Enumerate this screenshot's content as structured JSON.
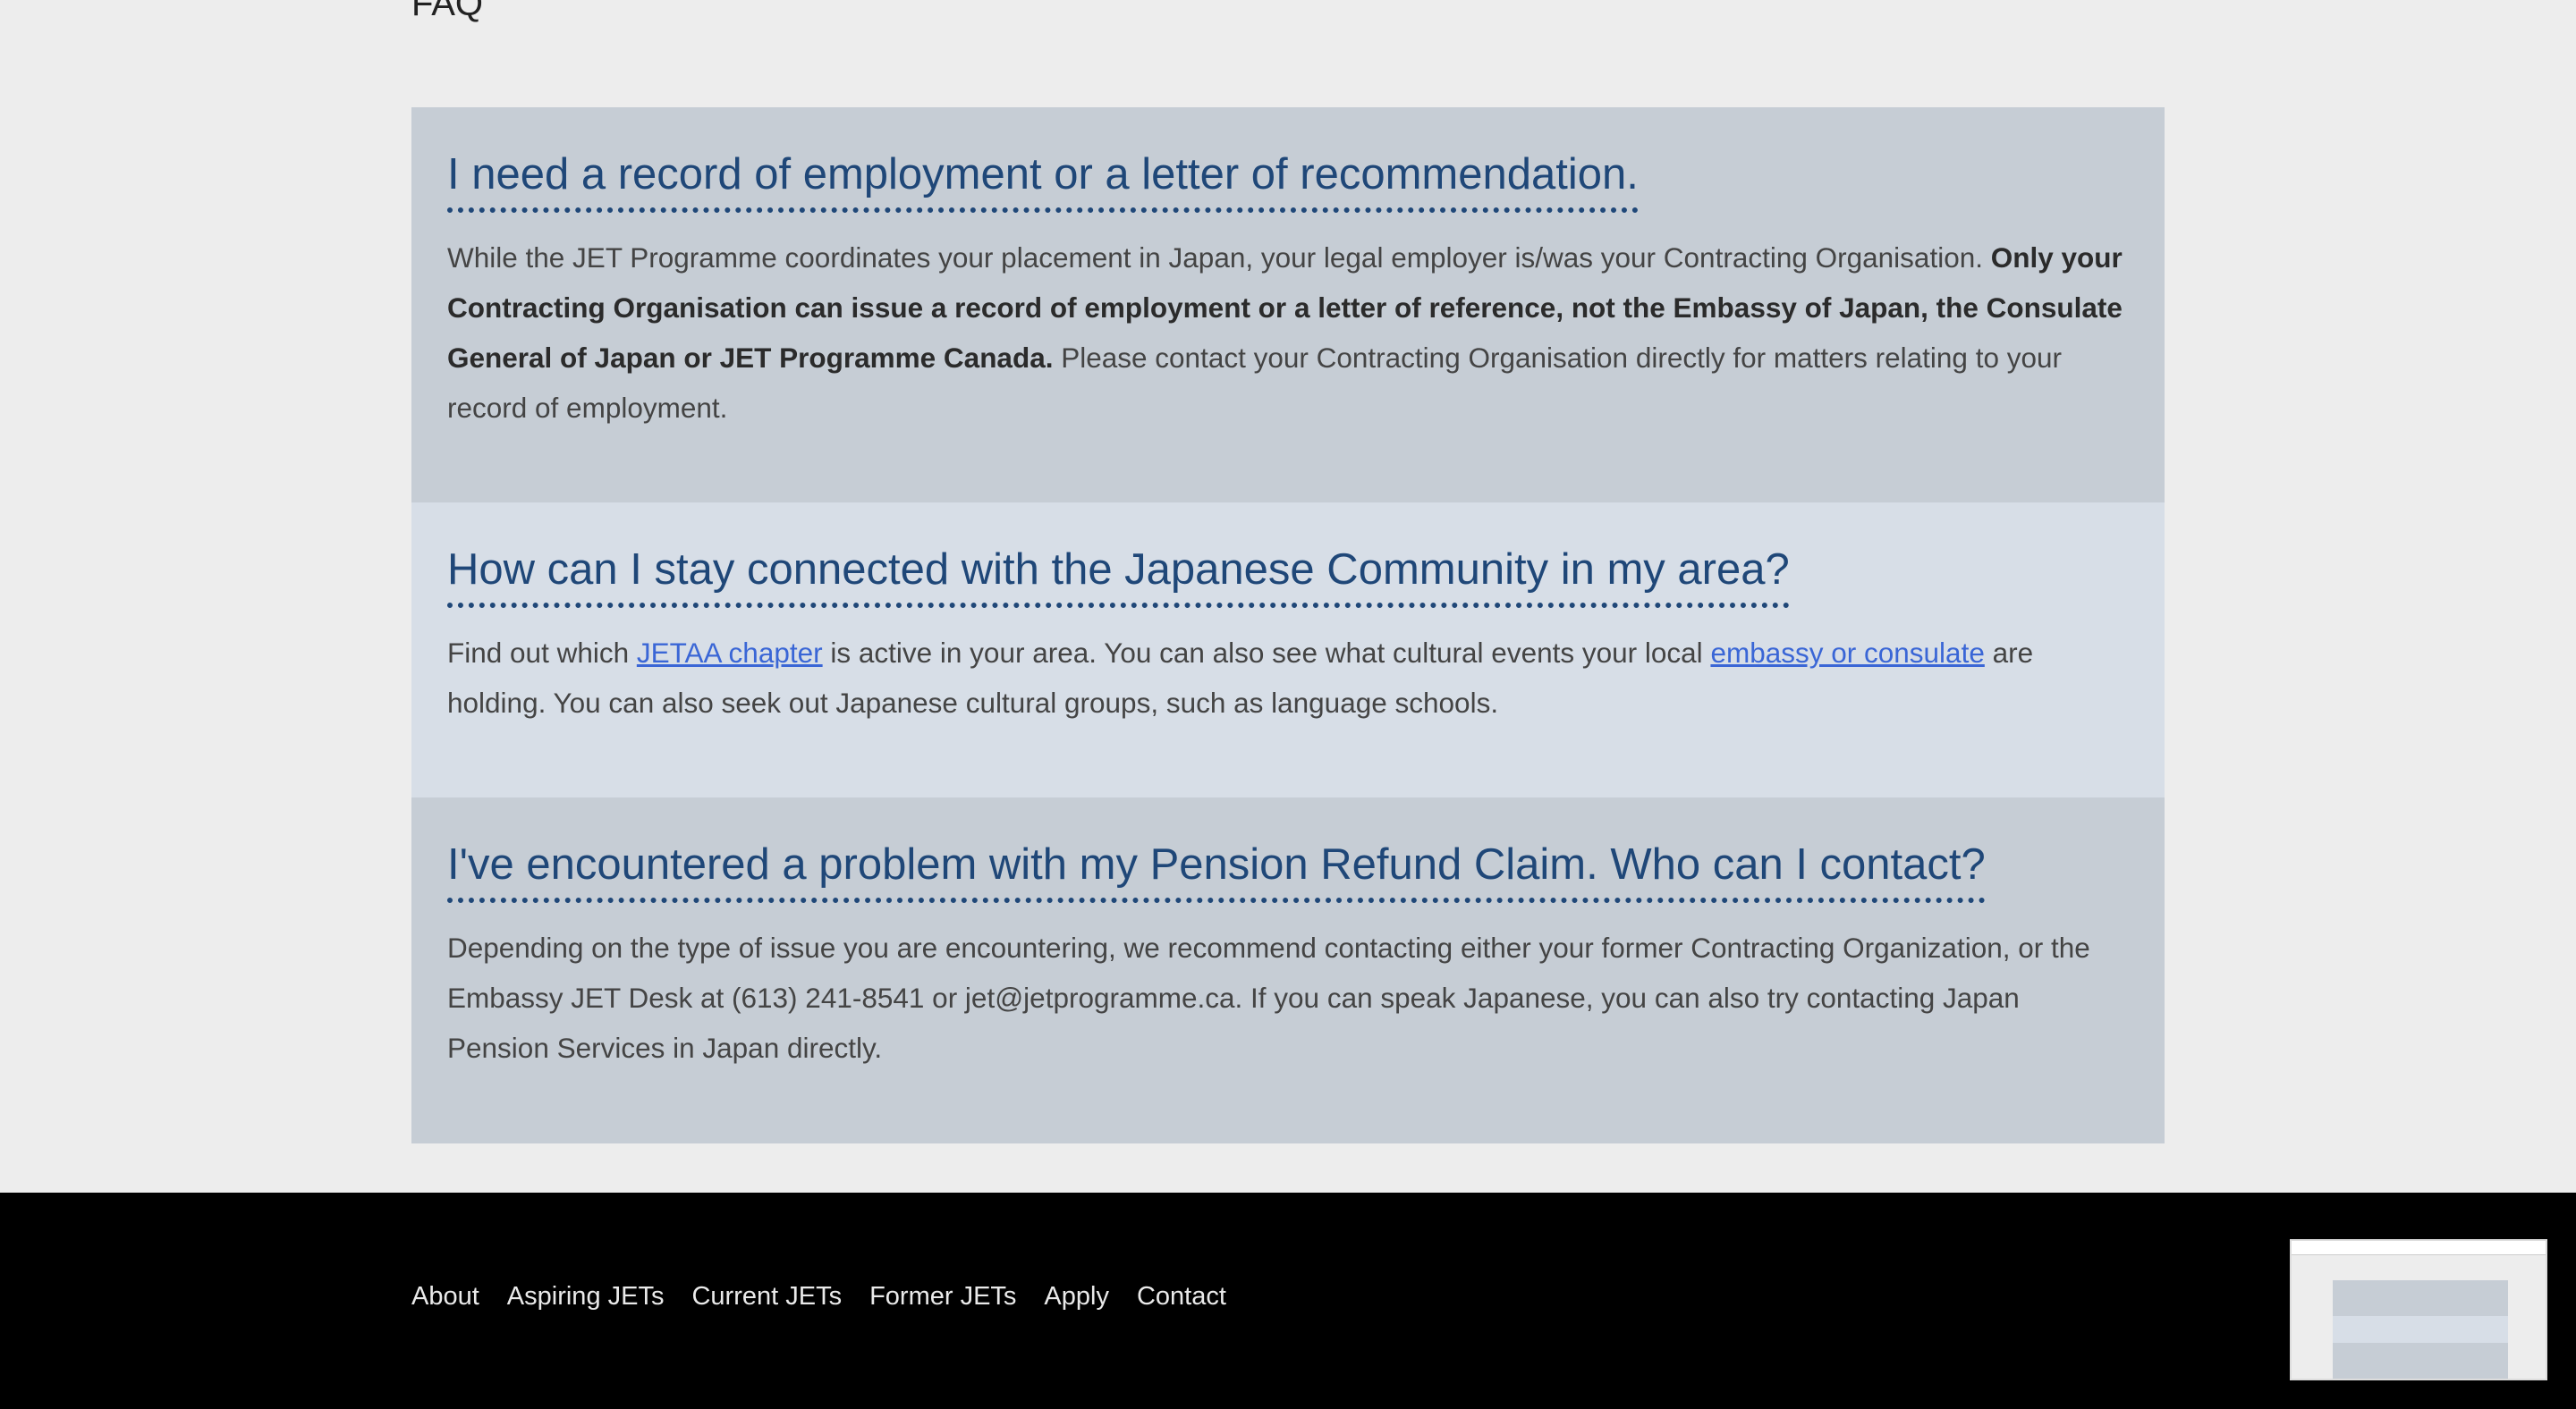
{
  "top_fragment": "FAQ",
  "faq": [
    {
      "question": "I need a record of employment or a letter of recommendation.",
      "answer_parts": [
        "While the JET Programme coordinates your placement in Japan, your legal employer is/was your Contracting Organisation. ",
        "Only your Contracting Organisation can issue a record of employment or a letter of reference, not the Embassy of Japan, the Consulate General of Japan or JET Programme Canada.",
        "  Please contact your Contracting Organisation directly for matters relating to your record of employment."
      ]
    },
    {
      "question": "How can I stay connected with the Japanese Community in my area?",
      "answer_parts": [
        "Find out which ",
        "JETAA chapter",
        " is active in your area. You can also see what cultural events your local ",
        "embassy or consulate",
        " are holding. You can also seek out Japanese cultural groups, such as language schools."
      ]
    },
    {
      "question": "I've encountered a problem with my Pension Refund Claim. Who can I contact?",
      "answer": "Depending on the type of issue you are encountering, we recommend contacting either your former Contracting Organization, or the Embassy JET Desk at (613) 241-8541 or jet@jetprogramme.ca. If you can speak Japanese, you can also try contacting Japan Pension Services in Japan directly."
    }
  ],
  "footer": {
    "nav": [
      "About",
      "Aspiring JETs",
      "Current JETs",
      "Former JETs",
      "Apply",
      "Contact"
    ]
  },
  "colors": {
    "heading": "#1f4778",
    "link": "#3a66d6",
    "panel_dark": "#c6cdd5",
    "panel_light": "#d7dee7",
    "footer_bg": "#000000",
    "page_bg": "#ededed"
  }
}
